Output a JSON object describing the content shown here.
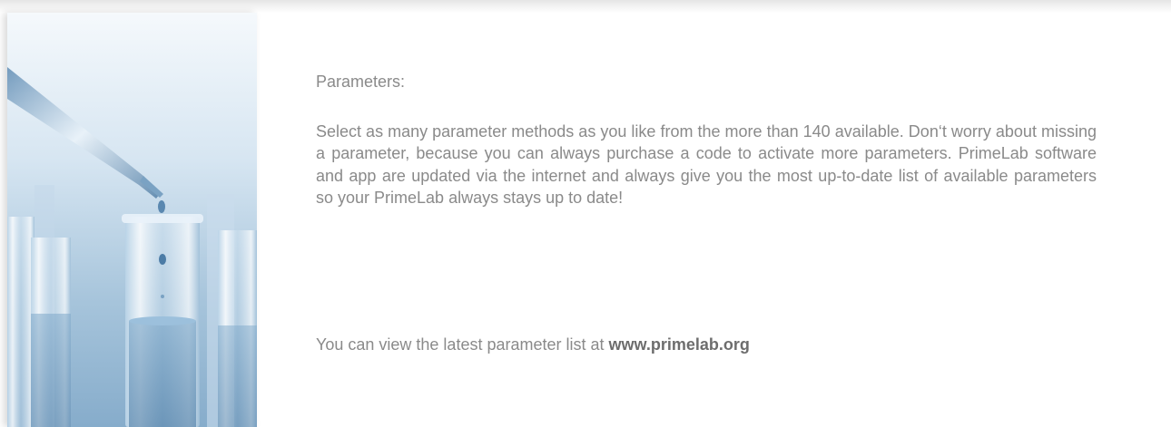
{
  "section": {
    "heading": "Parameters:",
    "body": "Select as many parameter methods as you like from the more than 140 availa­ble. Don‘t worry about missing a parameter, because you can always purchase a code to activate more parameters. PrimeLab software and app are updated via the internet and always give you the most up-to-date list of available parameters so your PrimeLab always stays up to date!",
    "footer_prefix": "You can view the latest parameter list at ",
    "footer_link": "www.primelab.org"
  },
  "image": {
    "subject": "laboratory-pipette-and-test-tubes"
  }
}
